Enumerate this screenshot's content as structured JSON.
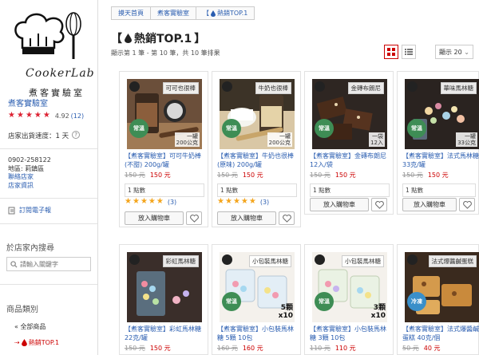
{
  "store": {
    "logo_brand": "CookerLab",
    "logo_sub": "煮客實驗室",
    "name": "煮客實驗室",
    "rating": "4.92",
    "rating_count": "(12)",
    "ship_label": "店家出貨速度：1 天",
    "phone": "0902-258122",
    "location": "地區: 莉鎮區",
    "contact_link": "聯絡店家",
    "info_link": "店家資訊",
    "subscribe": "訂閱電子報"
  },
  "sidebar": {
    "search_title": "於店家內搜尋",
    "search_placeholder": "請輸入關鍵字",
    "category_title": "商品類別",
    "categories": [
      {
        "label": "« 全部商品"
      },
      {
        "label": "熱銷TOP.1"
      }
    ]
  },
  "breadcrumb": [
    "摸天首頁",
    "煮客實驗室",
    "熱銷TOP.1"
  ],
  "page": {
    "title": "熱銷TOP.1",
    "title_bracket_open": "【",
    "title_bracket_close": "】",
    "result_info": "顯示第 1 筆 - 第 10 筆，共 10 筆排果",
    "per_page": "顯示 20",
    "colors": {
      "accent": "#c00000",
      "link": "#2a5db0",
      "star": "#f4a51c"
    }
  },
  "products": [
    {
      "img_label": "可可也很棒",
      "img_spec": "一罐\n200公克",
      "title": "【煮客實驗室】可可牛奶棒(不甜) 200g/罐",
      "old_price": "150 元",
      "price": "150 元",
      "badge": "1 點數",
      "rating_count": "(3)",
      "cart": "放入購物車",
      "green": "常溫"
    },
    {
      "img_label": "牛奶也很棒",
      "img_spec": "一罐\n200公克",
      "title": "【煮客實驗室】牛奶也很棒(原味) 200g/罐",
      "old_price": "150 元",
      "price": "150 元",
      "badge": "1 點數",
      "rating_count": "(3)",
      "cart": "放入購物車",
      "green": "常溫"
    },
    {
      "img_label": "金磚布朗尼",
      "img_spec": "一袋\n12入",
      "title": "【煮客實驗室】金磚布朗尼 12入/袋",
      "old_price": "150 元",
      "price": "150 元",
      "badge": "1 點數",
      "rating_count": "",
      "cart": "放入購物車",
      "green": "常溫"
    },
    {
      "img_label": "華味馬林糖",
      "img_spec": "一罐\n33公克",
      "title": "【煮客實驗室】法式馬林糖 33克/罐",
      "old_price": "150 元",
      "price": "150 元",
      "badge": "1 點數",
      "rating_count": "",
      "cart": "放入購物車",
      "green": "常溫"
    },
    {
      "img_label": "彩虹馬林糖",
      "img_spec": "",
      "title": "【煮客實驗室】彩虹馬林糖 22克/罐",
      "old_price": "150 元",
      "price": "150 元",
      "badge": "",
      "rating_count": "",
      "cart": "",
      "green": ""
    },
    {
      "img_label": "小包裝馬林糖",
      "img_spec": "",
      "x10": "5顆\nx10",
      "title": "【煮客實驗室】小包裝馬林糖 5顆 10包",
      "old_price": "160 元",
      "price": "160 元",
      "badge": "",
      "rating_count": "",
      "cart": "",
      "green": "常溫"
    },
    {
      "img_label": "小包裝馬林糖",
      "img_spec": "",
      "x10": "3顆\nx10",
      "title": "【煮客實驗室】小包裝馬林糖 3顆 10包",
      "old_price": "110 元",
      "price": "110 元",
      "badge": "",
      "rating_count": "",
      "cart": "",
      "green": "常溫"
    },
    {
      "img_label": "法式爆醬鹹蛋糕",
      "img_spec": "",
      "title": "【煮客實驗室】法式爆醬鹹蛋糕 40克/個",
      "old_price": "50 元",
      "price": "40 元",
      "badge": "",
      "rating_count": "",
      "cart": "",
      "green": "冷凍"
    }
  ]
}
